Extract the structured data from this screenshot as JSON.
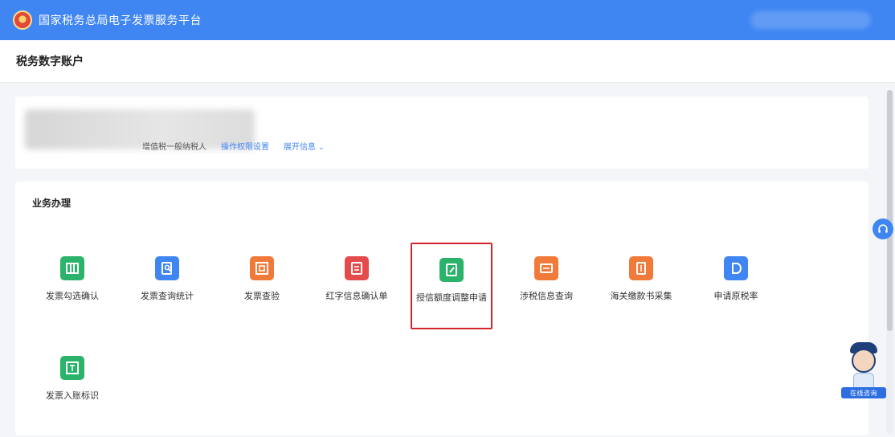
{
  "header": {
    "title": "国家税务总局电子发票服务平台",
    "emblem_icon": "tax-emblem-icon",
    "bg_color": "#3f86f3"
  },
  "subheader": {
    "title": "税务数字账户"
  },
  "account": {
    "taxpayer_type": "增值税一般纳税人",
    "link_settings": "操作权限设置",
    "link_more": "展开信息",
    "more_icon": "chevron-down-icon"
  },
  "business": {
    "section_title": "业务办理",
    "tiles": [
      {
        "label": "发票勾选确认",
        "icon": "check-grid-icon",
        "color": "#2bb36b"
      },
      {
        "label": "发票查询统计",
        "icon": "doc-search-icon",
        "color": "#3f86f3"
      },
      {
        "label": "发票查验",
        "icon": "verify-frame-icon",
        "color": "#f07a3a"
      },
      {
        "label": "红字信息确认单",
        "icon": "red-doc-icon",
        "color": "#e54b4b"
      },
      {
        "label": "授信额度调整申请",
        "icon": "edit-doc-icon",
        "color": "#2bb36b"
      },
      {
        "label": "涉税信息查询",
        "icon": "info-card-icon",
        "color": "#f07a3a"
      },
      {
        "label": "海关缴款书采集",
        "icon": "customs-doc-icon",
        "color": "#f07a3a"
      },
      {
        "label": "申请原税率",
        "icon": "doc-d-icon",
        "color": "#3f86f3"
      },
      {
        "label": "发票入账标识",
        "icon": "stamp-grid-icon",
        "color": "#2bb36b"
      }
    ]
  },
  "assistant": {
    "badge": "在线咨询"
  },
  "support": {
    "icon": "headset-icon"
  }
}
